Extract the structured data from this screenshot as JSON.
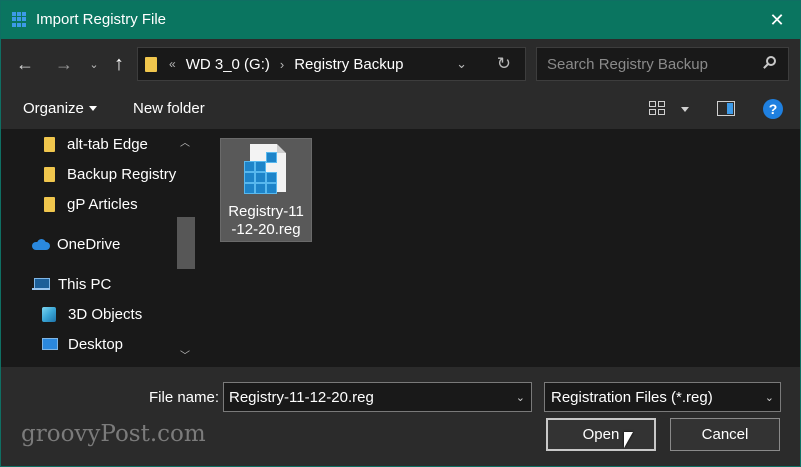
{
  "window": {
    "title": "Import Registry File",
    "close_glyph": "✕"
  },
  "nav": {
    "back_glyph": "←",
    "forward_glyph": "→",
    "recent_glyph": "⌄",
    "up_glyph": "↑"
  },
  "address": {
    "overflow_glyph": "«",
    "segments": [
      "WD 3_0 (G:)",
      "Registry Backup"
    ],
    "separator": "›",
    "dropdown_glyph": "⌄",
    "refresh_glyph": "↻"
  },
  "search": {
    "placeholder": "Search Registry Backup"
  },
  "toolbar": {
    "organize_label": "Organize",
    "new_folder_label": "New folder",
    "help_glyph": "?"
  },
  "navpane": {
    "items": [
      {
        "label": "alt-tab Edge",
        "icon": "folder-icon"
      },
      {
        "label": "Backup Registry",
        "icon": "folder-icon"
      },
      {
        "label": "gP Articles",
        "icon": "folder-icon"
      },
      {
        "label": "OneDrive",
        "icon": "onedrive-icon"
      },
      {
        "label": "This PC",
        "icon": "this-pc-icon"
      },
      {
        "label": "3D Objects",
        "icon": "3d-objects-icon"
      },
      {
        "label": "Desktop",
        "icon": "desktop-icon"
      }
    ],
    "scroll_up_glyph": "︿",
    "scroll_down_glyph": "﹀"
  },
  "files": [
    {
      "name_line1": "Registry-11",
      "name_line2": "-12-20.reg",
      "icon": "registry-file-icon",
      "selected": true
    }
  ],
  "bottom": {
    "file_name_label": "File name:",
    "file_name_value": "Registry-11-12-20.reg",
    "file_type_value": "Registration Files (*.reg)",
    "dropdown_glyph": "⌄",
    "open_label": "Open",
    "cancel_label": "Cancel",
    "watermark": "groovyPost.com"
  },
  "colors": {
    "titlebar": "#0a7560",
    "background": "#191919",
    "panel": "#2b2b2b",
    "folder": "#f0c64d",
    "accent_blue": "#1f80e0"
  }
}
